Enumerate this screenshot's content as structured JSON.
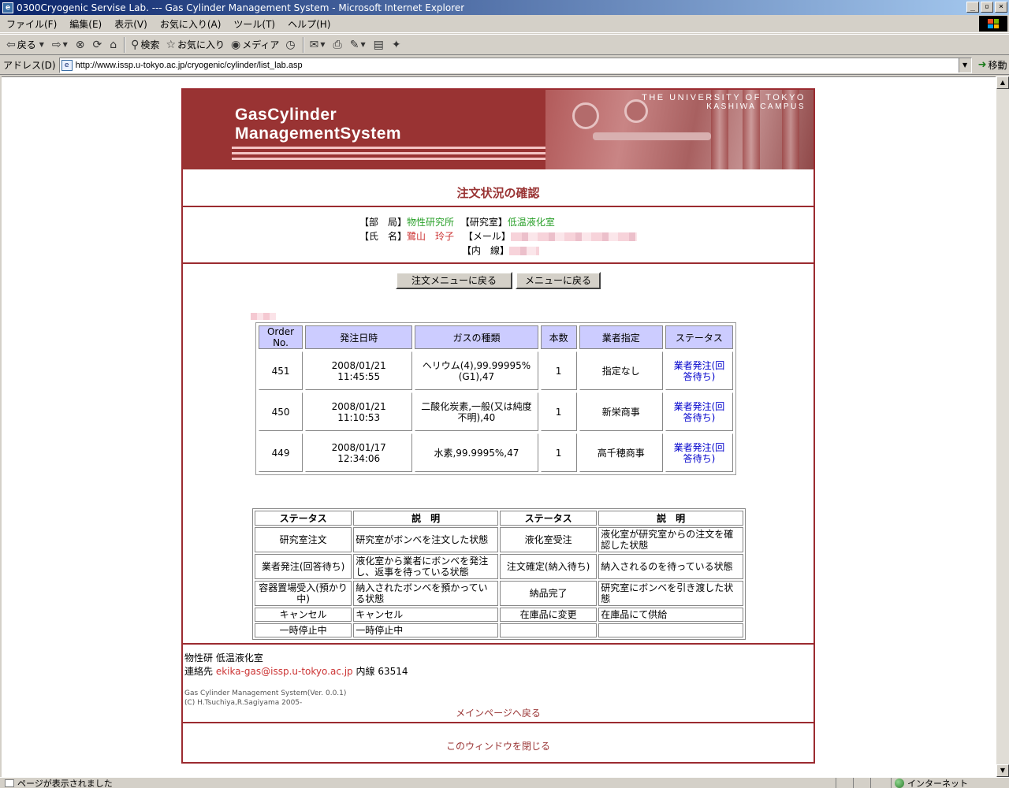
{
  "window": {
    "title": "0300Cryogenic Servise Lab. --- Gas Cylinder Management System - Microsoft Internet Explorer",
    "buttons": {
      "minimize": "_",
      "maximize": "▫",
      "close": "×"
    }
  },
  "menu": [
    "ファイル(F)",
    "編集(E)",
    "表示(V)",
    "お気に入り(A)",
    "ツール(T)",
    "ヘルプ(H)"
  ],
  "toolbar": {
    "back": "戻る",
    "search": "検索",
    "favorites": "お気に入り",
    "media": "メディア"
  },
  "address": {
    "label": "アドレス(D)",
    "url": "http://www.issp.u-tokyo.ac.jp/cryogenic/cylinder/list_lab.asp",
    "go": "移動"
  },
  "banner": {
    "line1": "GasCylinder",
    "line2": "ManagementSystem",
    "univ1": "THE UNIVERSITY OF TOKYO",
    "univ2": "KASHIWA CAMPUS"
  },
  "page_title": "注文状況の確認",
  "user": {
    "dept_label": "【部　局】",
    "dept_value": "物性研究所",
    "lab_label": "【研究室】",
    "lab_value": "低温液化室",
    "name_label": "【氏　名】",
    "name_value": "鷺山　玲子",
    "mail_label": "【メール】",
    "ext_label": "【内　線】"
  },
  "buttons": {
    "order_menu": "注文メニューに戻る",
    "main_menu": "メニューに戻る"
  },
  "orders": {
    "headers": [
      "Order No.",
      "発注日時",
      "ガスの種類",
      "本数",
      "業者指定",
      "ステータス"
    ],
    "rows": [
      {
        "no": "451",
        "date": "2008/01/21 11:45:55",
        "gas": "ヘリウム(4),99.99995%(G1),47",
        "qty": "1",
        "vendor": "指定なし",
        "status": "業者発注(回答待ち)"
      },
      {
        "no": "450",
        "date": "2008/01/21 11:10:53",
        "gas": "二酸化炭素,一般(又は純度不明),40",
        "qty": "1",
        "vendor": "新栄商事",
        "status": "業者発注(回答待ち)"
      },
      {
        "no": "449",
        "date": "2008/01/17 12:34:06",
        "gas": "水素,99.9995%,47",
        "qty": "1",
        "vendor": "高千穂商事",
        "status": "業者発注(回答待ち)"
      }
    ]
  },
  "legend": {
    "headers": [
      "ステータス",
      "説　明",
      "ステータス",
      "説　明"
    ],
    "rows": [
      [
        "研究室注文",
        "研究室がボンベを注文した状態",
        "液化室受注",
        "液化室が研究室からの注文を確認した状態"
      ],
      [
        "業者発注(回答待ち)",
        "液化室から業者にボンベを発注し、返事を待っている状態",
        "注文確定(納入待ち)",
        "納入されるのを待っている状態"
      ],
      [
        "容器置場受入(預かり中)",
        "納入されたボンベを預かっている状態",
        "納品完了",
        "研究室にボンベを引き渡した状態"
      ],
      [
        "キャンセル",
        "キャンセル",
        "在庫品に変更",
        "在庫品にて供給"
      ],
      [
        "一時停止中",
        "一時停止中",
        "",
        ""
      ]
    ]
  },
  "footer": {
    "org": "物性研 低温液化室",
    "contact_prefix": "連絡先 ",
    "email": "ekika-gas@issp.u-tokyo.ac.jp",
    "ext": " 内線 63514",
    "version": "Gas Cylinder Management System(Ver. 0.0.1)",
    "copyright": "(C) H.Tsuchiya,R.Sagiyama 2005-",
    "main_link": "メインページへ戻る",
    "close_link": "このウィンドウを閉じる"
  },
  "statusbar": {
    "text": "ページが表示されました",
    "zone": "インターネット"
  }
}
